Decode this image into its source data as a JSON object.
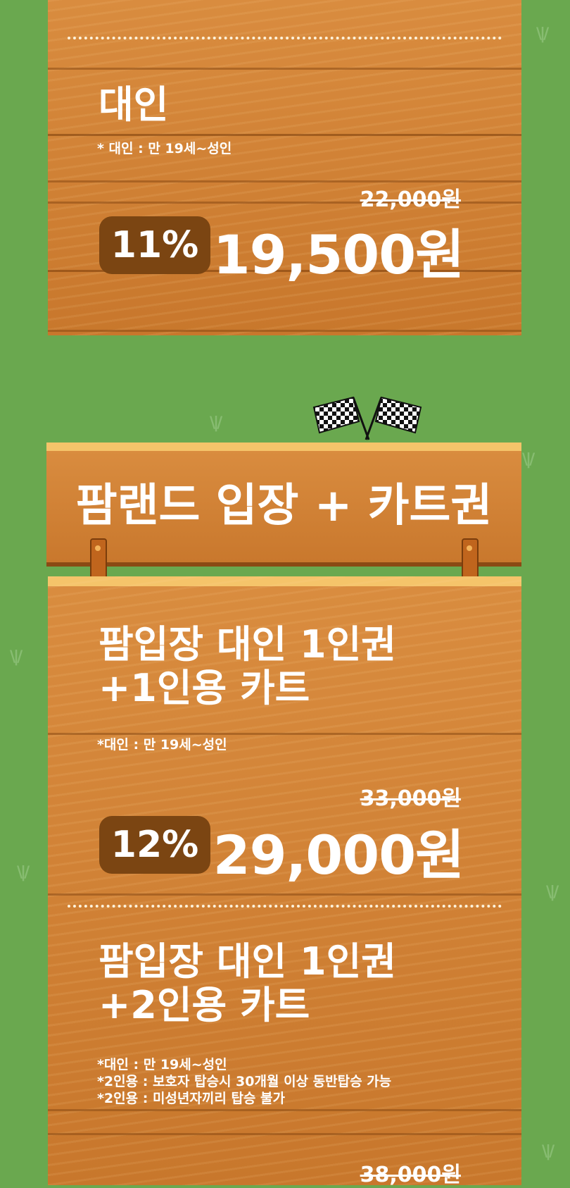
{
  "colors": {
    "background": "#6aa84f",
    "wood": "#d98c3f",
    "badge": "#7b4512",
    "text": "#ffffff"
  },
  "top_card": {
    "title": "대인",
    "note": "* 대인 : 만 19세~성인",
    "old_price": "22,000원",
    "discount": "11%",
    "price": "19,500원"
  },
  "section_header": {
    "title": "팜랜드 입장 + 카트권",
    "icon": "checkered-flags-icon"
  },
  "items": [
    {
      "title_line1": "팜입장 대인 1인권",
      "title_line2": "+1인용 카트",
      "notes": [
        "*대인 : 만 19세~성인"
      ],
      "old_price": "33,000원",
      "discount": "12%",
      "price": "29,000원"
    },
    {
      "title_line1": "팜입장 대인 1인권",
      "title_line2": "+2인용 카트",
      "notes": [
        "*대인 : 만 19세~성인",
        "*2인용 : 보호자 탑승시 30개월 이상 동반탑승 가능",
        "*2인용 : 미성년자끼리 탑승 불가"
      ],
      "old_price": "38,000원"
    }
  ]
}
